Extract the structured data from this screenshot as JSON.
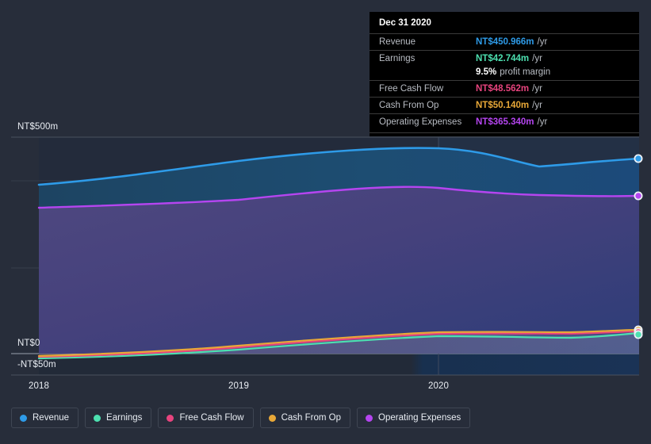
{
  "background_color": "#272d3a",
  "tooltip": {
    "title": "Dec 31 2020",
    "rows": [
      {
        "key": "Revenue",
        "value": "NT$450.966m",
        "unit": "/yr",
        "color": "#2e9be8"
      },
      {
        "key": "Earnings",
        "value": "NT$42.744m",
        "unit": "/yr",
        "color": "#4de0b0"
      },
      {
        "key": "Free Cash Flow",
        "value": "NT$48.562m",
        "unit": "/yr",
        "color": "#e8447e"
      },
      {
        "key": "Cash From Op",
        "value": "NT$50.140m",
        "unit": "/yr",
        "color": "#e8a838"
      },
      {
        "key": "Operating Expenses",
        "value": "NT$365.340m",
        "unit": "/yr",
        "color": "#b545f0"
      }
    ],
    "sub_row": {
      "value": "9.5%",
      "text": "profit margin"
    }
  },
  "axes": {
    "y_labels": [
      "NT$500m",
      "NT$0",
      "-NT$50m"
    ],
    "x_labels": [
      "2018",
      "2019",
      "2020"
    ]
  },
  "legend": {
    "items": [
      {
        "label": "Revenue",
        "color": "#2e9be8"
      },
      {
        "label": "Earnings",
        "color": "#4de0b0"
      },
      {
        "label": "Free Cash Flow",
        "color": "#e8447e"
      },
      {
        "label": "Cash From Op",
        "color": "#e8a838"
      },
      {
        "label": "Operating Expenses",
        "color": "#b545f0"
      }
    ]
  },
  "chart_data": {
    "type": "area",
    "title": "",
    "xlabel": "",
    "ylabel": "",
    "currency": "NT$",
    "units": "millions per year",
    "ylim": [
      -50,
      500
    ],
    "y_ticks": [
      500,
      250,
      0,
      -50
    ],
    "y_tick_labels": [
      "NT$500m",
      "",
      "NT$0",
      "-NT$50m"
    ],
    "x_ticks": [
      "2018",
      "2019",
      "2020"
    ],
    "grid": true,
    "legend_position": "bottom-left",
    "x": [
      "2017-12-31",
      "2018-06-30",
      "2018-12-31",
      "2019-06-30",
      "2019-12-31",
      "2020-06-30",
      "2020-09-30",
      "2020-12-31"
    ],
    "series": [
      {
        "name": "Revenue",
        "color": "#2e9be8",
        "values": [
          406,
          424,
          447,
          468,
          487,
          467,
          450,
          450.966
        ]
      },
      {
        "name": "Operating Expenses",
        "color": "#b545f0",
        "values": [
          352,
          363,
          376,
          388,
          398,
          382,
          368,
          365.34
        ]
      },
      {
        "name": "Cash From Op",
        "color": "#e8a838",
        "values": [
          -3,
          3,
          10,
          22,
          34,
          42,
          45,
          50.14
        ]
      },
      {
        "name": "Free Cash Flow",
        "color": "#e8447e",
        "values": [
          -4,
          1,
          8,
          19,
          30,
          38,
          42,
          48.562
        ]
      },
      {
        "name": "Earnings",
        "color": "#4de0b0",
        "values": [
          -8,
          -4,
          4,
          16,
          28,
          33,
          32,
          42.744
        ]
      }
    ],
    "highlight_date": "Dec 31 2020",
    "profit_margin": "9.5%"
  }
}
